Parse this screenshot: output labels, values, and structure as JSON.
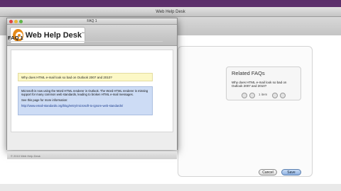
{
  "main_window": {
    "title": "Web Help Desk"
  },
  "popup": {
    "tab_title": "FAQ 1",
    "logo_text": "Web Help Desk",
    "logo_tm": "™",
    "faq_heading": "FAQ 1",
    "question": "Why does HTML e-mail look so bad on Outlook 2007 and 2010?",
    "answer_p1": "Microsoft is now using the Word HTML renderer in Outlook. The Word HTML renderer is missing support for many common web standards, leading to broken HTML e-mail messages.",
    "answer_p2": "See this page for more information:",
    "answer_link": "http://www.email-standards.org/blog/entry/microsoft-to-ignore-web-standards/",
    "footer": "© 2010 Web Help Desk"
  },
  "related": {
    "title": "Related FAQs",
    "item": "Why does HTML e-mail look so bad on Outlook 2007 and 2010?",
    "pager": "1 item"
  },
  "buttons": {
    "cancel": "Cancel",
    "save": "Save"
  },
  "colors": {
    "desktop": "#6a3d78",
    "question_bg": "#fcf8c6",
    "answer_bg": "#cddcf5",
    "logo_orange": "#e68a1a"
  }
}
